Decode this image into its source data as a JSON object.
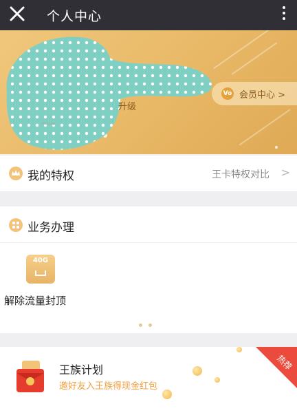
{
  "topbar": {
    "title": "个人中心"
  },
  "banner": {
    "level_text": "升级",
    "vip_badge": "Vo",
    "vip_center_label": "会员中心 >"
  },
  "privilege": {
    "title": "我的特权",
    "compare_label": "王卡特权对比",
    "chevron": ">"
  },
  "business": {
    "title": "业务办理",
    "items": [
      {
        "icon_text": "40G",
        "label": "解除流量封顶"
      }
    ]
  },
  "plan": {
    "title": "王族计划",
    "subtitle": "邀好友入王族得现金红包",
    "badge": "热荐"
  },
  "colors": {
    "topbar": "#2f2f35",
    "banner": "#e8b866",
    "accent": "#f0a040",
    "hot": "#ea4b3c"
  }
}
